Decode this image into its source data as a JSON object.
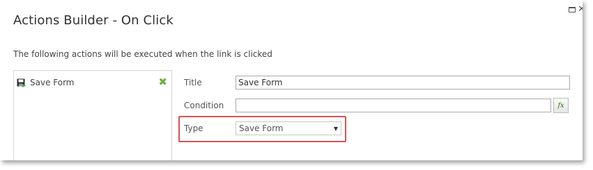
{
  "dialog": {
    "title": "Actions Builder - On Click",
    "description": "The following actions will be executed when the link is clicked"
  },
  "actions_list": {
    "items": [
      {
        "label": "Save Form",
        "icon": "save-form-icon"
      }
    ]
  },
  "form": {
    "title_label": "Title",
    "title_value": "Save Form",
    "condition_label": "Condition",
    "condition_value": "",
    "fx_label": "fx",
    "type_label": "Type",
    "type_selected": "Save Form"
  },
  "colors": {
    "remove_icon": "#6cb33f",
    "highlight": "#d9534f"
  }
}
